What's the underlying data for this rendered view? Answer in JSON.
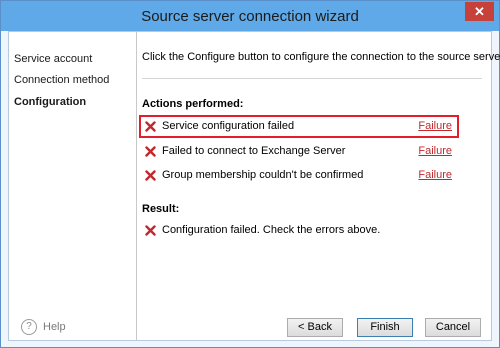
{
  "window": {
    "title": "Source server connection wizard",
    "close_label": "✕"
  },
  "sidebar": {
    "items": [
      {
        "label": "Service account",
        "active": false
      },
      {
        "label": "Connection method",
        "active": false
      },
      {
        "label": "Configuration",
        "active": true
      }
    ]
  },
  "main": {
    "intro": "Click the Configure button to configure the connection to the source server.",
    "actions_heading": "Actions performed:",
    "actions": [
      {
        "text": "Service configuration failed",
        "status": "Failure",
        "icon": "x-error-icon",
        "highlighted": true
      },
      {
        "text": "Failed to connect to Exchange Server",
        "status": "Failure",
        "icon": "x-error-icon",
        "highlighted": false
      },
      {
        "text": "Group membership couldn't be confirmed",
        "status": "Failure",
        "icon": "x-error-icon",
        "highlighted": false
      }
    ],
    "result_heading": "Result:",
    "result": {
      "text": "Configuration failed. Check the errors above.",
      "icon": "x-error-icon"
    }
  },
  "footer": {
    "help_label": "Help",
    "help_icon_glyph": "?",
    "back_label": "< Back",
    "finish_label": "Finish",
    "cancel_label": "Cancel"
  },
  "colors": {
    "titlebar": "#5fa9e8",
    "error": "#c0292d",
    "highlight_border": "#e31d2b",
    "close_button": "#c7413b"
  }
}
